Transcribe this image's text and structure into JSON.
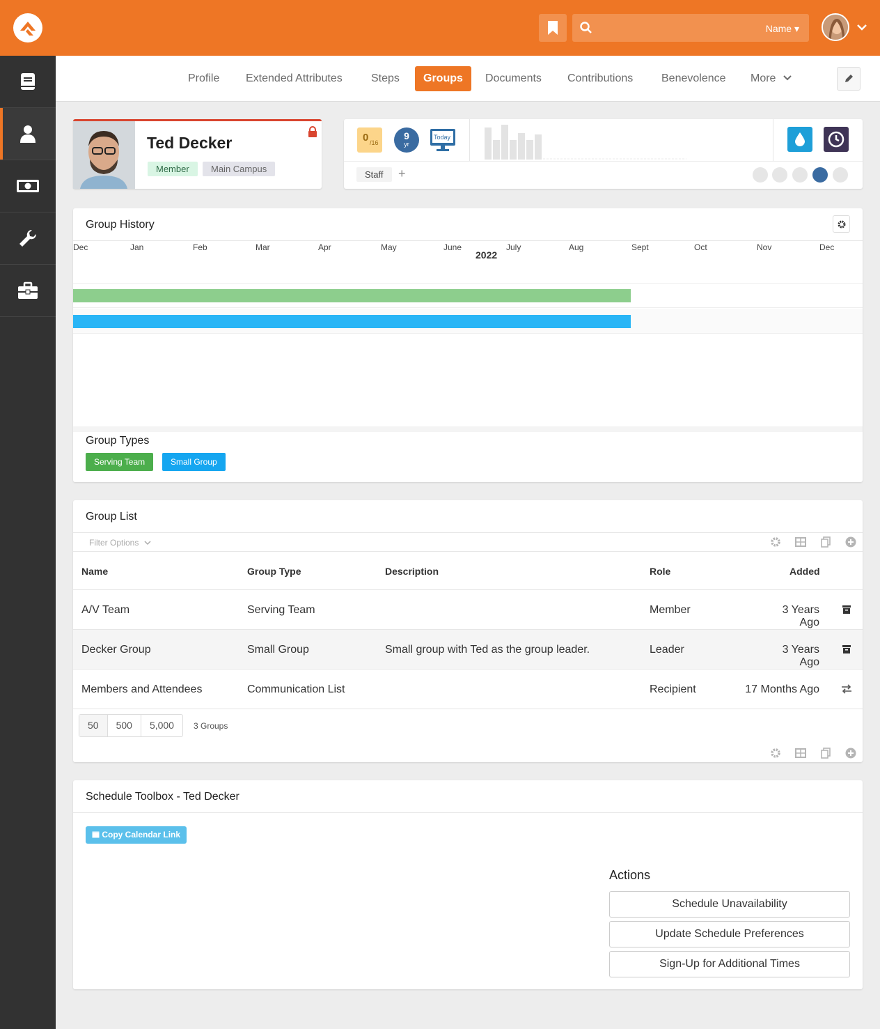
{
  "header": {
    "search_filter": "Name",
    "icons": {
      "logo": "rock-logo-icon",
      "bookmark": "bookmark-icon",
      "search": "search-icon",
      "chevron": "chevron-down-icon"
    }
  },
  "sidebar": {
    "items": [
      {
        "name": "book-icon",
        "active": false
      },
      {
        "name": "person-icon",
        "active": true
      },
      {
        "name": "money-icon",
        "active": false
      },
      {
        "name": "wrench-icon",
        "active": false
      },
      {
        "name": "briefcase-icon",
        "active": false
      }
    ]
  },
  "tabs": [
    "Profile",
    "Extended Attributes",
    "Steps",
    "Groups",
    "Documents",
    "Contributions",
    "Benevolence",
    "More"
  ],
  "active_tab": "Groups",
  "person": {
    "name": "Ted Decker",
    "badges": [
      "Member",
      "Main Campus"
    ]
  },
  "badges_bar": {
    "score": "0",
    "score_denominator": "/16",
    "years": "9",
    "years_unit": "yr",
    "today_label": "Today",
    "staff_label": "Staff",
    "add_label": "+"
  },
  "group_history": {
    "title": "Group History",
    "year": "2022",
    "months": [
      "Dec",
      "Jan",
      "Feb",
      "Mar",
      "Apr",
      "May",
      "June",
      "July",
      "Aug",
      "Sept",
      "Oct",
      "Nov",
      "Dec"
    ],
    "bars": [
      {
        "color": "#8dce8d",
        "start_month_index": 0,
        "end_month_index": 8.9
      },
      {
        "color": "#29b5f6",
        "start_month_index": 0,
        "end_month_index": 8.9
      }
    ]
  },
  "group_types": {
    "title": "Group Types",
    "items": [
      {
        "label": "Serving Team",
        "color": "#4cae4c"
      },
      {
        "label": "Small Group",
        "color": "#15a6f0"
      }
    ]
  },
  "group_list": {
    "title": "Group List",
    "filter_label": "Filter Options",
    "columns": [
      "Name",
      "Group Type",
      "Description",
      "Role",
      "Added"
    ],
    "rows": [
      {
        "name": "A/V Team",
        "type": "Serving Team",
        "description": "",
        "role": "Member",
        "added": "3 Years Ago",
        "icon": "archive-icon"
      },
      {
        "name": "Decker Group",
        "type": "Small Group",
        "description": "Small group with Ted as the group leader.",
        "role": "Leader",
        "added": "3 Years Ago",
        "icon": "archive-icon"
      },
      {
        "name": "Members and Attendees",
        "type": "Communication List",
        "description": "",
        "role": "Recipient",
        "added": "17 Months Ago",
        "icon": "exchange-icon"
      }
    ],
    "page_sizes": [
      "50",
      "500",
      "5,000"
    ],
    "count_label": "3 Groups"
  },
  "schedule": {
    "title": "Schedule Toolbox - Ted Decker",
    "copy_link_label": "Copy Calendar Link",
    "actions_title": "Actions",
    "actions": [
      "Schedule Unavailability",
      "Update Schedule Preferences",
      "Sign-Up for Additional Times"
    ]
  },
  "colors": {
    "brand_orange": "#ee7625",
    "sidebar": "#323232",
    "member_badge_bg": "#d9f5e4",
    "campus_badge_bg": "#e3e3ea",
    "copy_link_bg": "#5bc0eb"
  }
}
